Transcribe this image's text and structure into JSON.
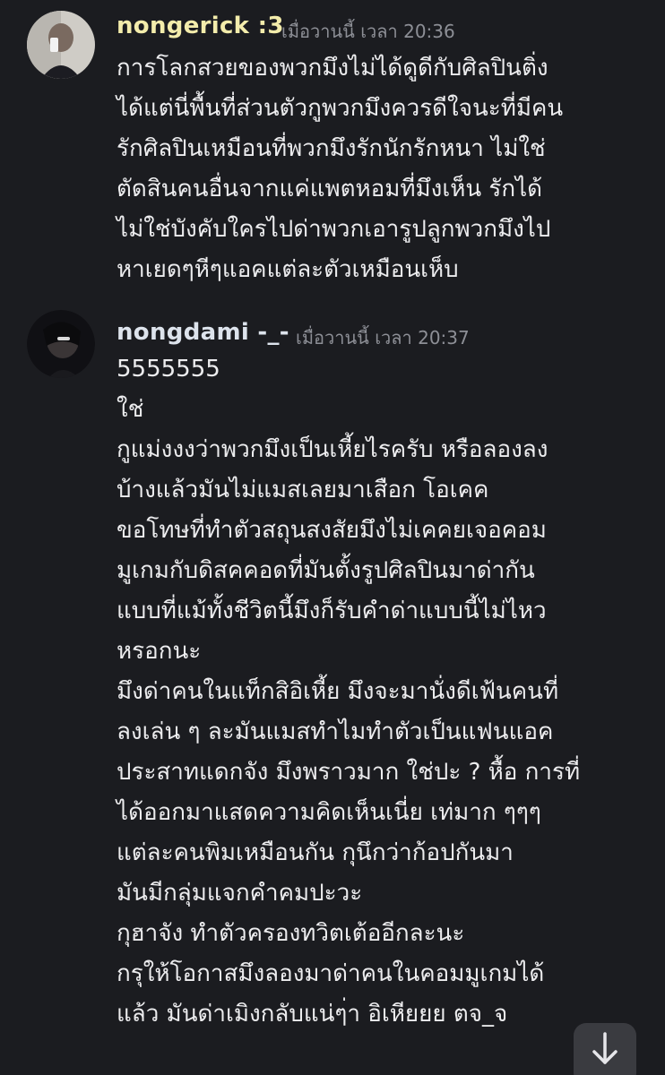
{
  "messages": [
    {
      "author": "nongerick :3",
      "author_color": "#f3ecab",
      "timestamp": "เมื่อวานนี้ เวลา 20:36",
      "lines": [
        "การโลกสวยของพวกมึงไม่ได้ดูดีกับศิลปินติ่ง",
        "ได้แต่นี่พื้นที่ส่วนตัวกูพวกมึงควรดีใจนะที่มีคน",
        "รักศิลปินเหมือนที่พวกมึงรักนักรักหนา ไม่ใช่",
        "ตัดสินคนอื่นจากแค่แพตหอมที่มึงเห็น รักได้",
        "ไม่ใช่บังคับใครไปด่าพวกเอารูปลูกพวกมึงไป",
        "หาเยดๆหีๆแอคแต่ละตัวเหมือนเห็บ"
      ]
    },
    {
      "author": "nongdami -_-",
      "author_color": "#dde3ec",
      "timestamp": "เมื่อวานนี้ เวลา 20:37",
      "lines": [
        "5555555",
        "ใช่",
        "กูแม่งงงว่าพวกมึงเป็นเหี้ยไรครับ หรือลองลง",
        "บ้างแล้วมันไม่แมสเลยมาเสือก โอเคค",
        "ขอโทษที่ทำตัวสถุนสงสัยมึงไม่เคคยเจอคอม",
        "มูเกมกับดิสคคอดที่มันตั้งรูปศิลปินมาด่ากัน",
        "แบบที่แม้ทั้งชีวิตนี้มึงก็รับคำด่าแบบนี้ไม่ไหว",
        "หรอกนะ",
        "มึงด่าคนในแท็กสิอิเหี้ย มึงจะมานั่งดีเฟ้นคนที่",
        "ลงเล่น ๆ ละมันแมสทำไมทำตัวเป็นแฟนแอค",
        "ประสาทแดกจัง มึงพราวมาก ใช่ปะ ? หื้อ การที่",
        "ได้ออกมาแสดความคิดเห็นเนี่ย เท่มาก ๆๆๆ",
        "แต่ละคนพิมเหมือนกัน กุนึกว่าก้อปกันมา",
        "มันมีกลุ่มแจกคำคมปะวะ",
        "กุฮาจัง ทำตัวครองทวิตเต้ออีกละนะ",
        "กรุให้โอกาสมึงลองมาด่าคนในคอมมูเกมได้",
        "แล้ว มันด่าเมิงกลับแน่ๆ่า อิเหียยย ตจ_จ"
      ]
    }
  ],
  "scroll_button": {
    "icon": "arrow-down-icon"
  }
}
